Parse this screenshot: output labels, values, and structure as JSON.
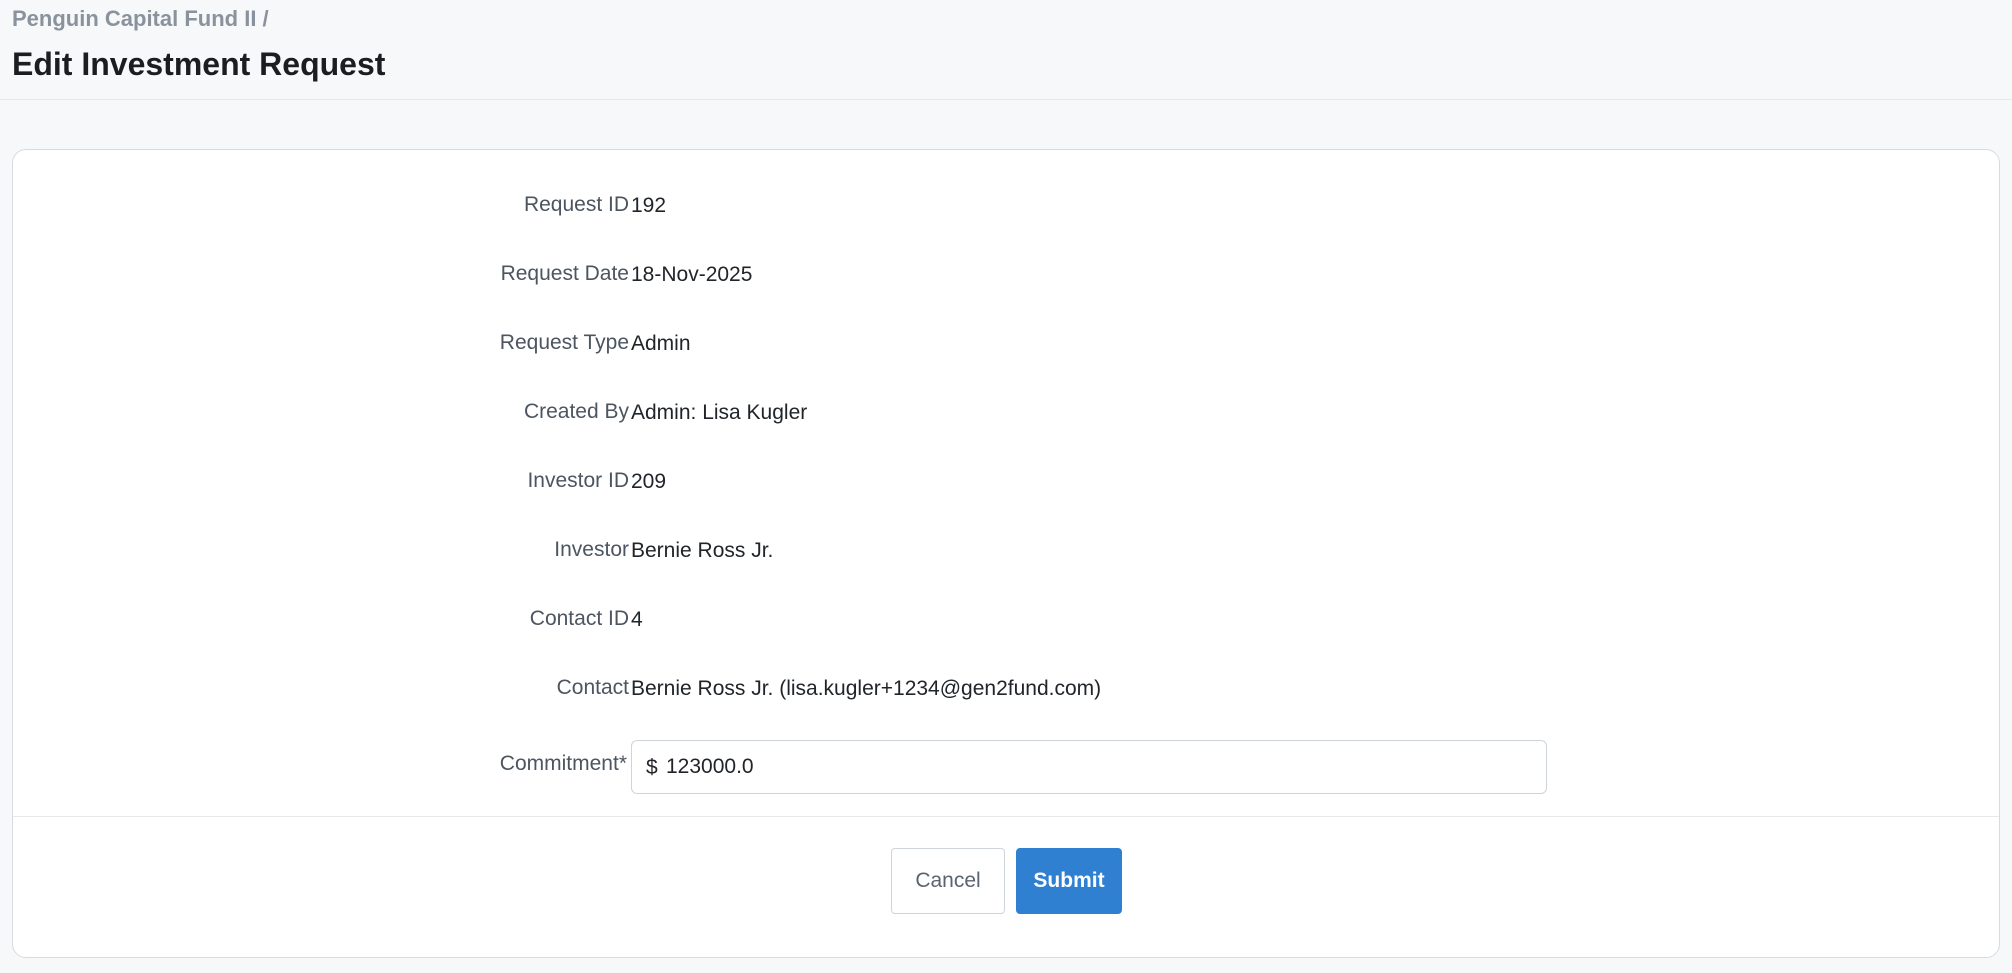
{
  "header": {
    "breadcrumb": "Penguin Capital Fund II /",
    "title": "Edit Investment Request"
  },
  "form": {
    "fields": [
      {
        "label": "Request ID",
        "value": "192"
      },
      {
        "label": "Request Date",
        "value": "18-Nov-2025"
      },
      {
        "label": "Request Type",
        "value": "Admin"
      },
      {
        "label": "Created By",
        "value": "Admin: Lisa Kugler"
      },
      {
        "label": "Investor ID",
        "value": "209"
      },
      {
        "label": "Investor",
        "value": "Bernie Ross Jr."
      },
      {
        "label": "Contact ID",
        "value": "4"
      },
      {
        "label": "Contact",
        "value": "Bernie Ross Jr. (lisa.kugler+1234@gen2fund.com)"
      }
    ],
    "commitment": {
      "label": "Commitment*",
      "currency_symbol": "$",
      "value": "123000.0"
    }
  },
  "actions": {
    "cancel_label": "Cancel",
    "submit_label": "Submit"
  },
  "colors": {
    "primary": "#2f80d1",
    "page_background": "#f7f8fa",
    "card_background": "#ffffff"
  }
}
